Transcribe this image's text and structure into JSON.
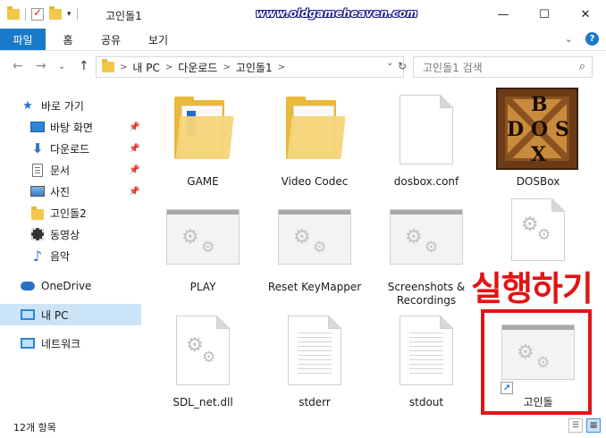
{
  "window": {
    "title": "고인돌1",
    "watermark": "www.oldgameheaven.com",
    "minimize": "—",
    "maximize": "☐",
    "close": "✕"
  },
  "ribbon": {
    "tabs": [
      "파일",
      "홈",
      "공유",
      "보기"
    ],
    "collapse": "⌄",
    "help": "?"
  },
  "nav": {
    "back": "←",
    "forward": "→",
    "recent": "⌄",
    "up": "↑",
    "path": [
      "내 PC",
      "다운로드",
      "고인돌1"
    ],
    "path_sep": ">",
    "path_dropdown": "⌄",
    "refresh": "↻",
    "search_placeholder": "고인돌1 검색",
    "search_icon": "⌕"
  },
  "sidebar": {
    "items": [
      {
        "label": "바로 가기",
        "icon": "star-icon",
        "pinned": false
      },
      {
        "label": "바탕 화면",
        "icon": "desktop-icon",
        "pinned": true
      },
      {
        "label": "다운로드",
        "icon": "download-icon",
        "pinned": true
      },
      {
        "label": "문서",
        "icon": "document-icon",
        "pinned": true
      },
      {
        "label": "사진",
        "icon": "pictures-icon",
        "pinned": true
      },
      {
        "label": "고인돌2",
        "icon": "folder-icon",
        "pinned": false
      },
      {
        "label": "동영상",
        "icon": "video-icon",
        "pinned": false
      },
      {
        "label": "음악",
        "icon": "music-icon",
        "pinned": false
      },
      {
        "label": "OneDrive",
        "icon": "onedrive-icon",
        "pinned": false
      },
      {
        "label": "내 PC",
        "icon": "pc-icon",
        "pinned": false
      },
      {
        "label": "네트워크",
        "icon": "network-icon",
        "pinned": false
      }
    ],
    "pin_glyph": "📌"
  },
  "files": [
    {
      "name": "GAME",
      "type": "folder"
    },
    {
      "name": "Video Codec",
      "type": "folder"
    },
    {
      "name": "dosbox.conf",
      "type": "file"
    },
    {
      "name": "DOSBox",
      "type": "dosbox"
    },
    {
      "name": "PLAY",
      "type": "exe"
    },
    {
      "name": "Reset KeyMapper",
      "type": "exe"
    },
    {
      "name": "Screenshots & Recordings",
      "type": "exe"
    },
    {
      "name": "",
      "type": "page-gear"
    },
    {
      "name": "SDL_net.dll",
      "type": "page-gear"
    },
    {
      "name": "stderr",
      "type": "text"
    },
    {
      "name": "stdout",
      "type": "text"
    },
    {
      "name": "고인돌",
      "type": "exe-shortcut"
    }
  ],
  "dosbox_letters": {
    "top": "B",
    "left": "D",
    "center": "O",
    "right": "S",
    "bottom": "X"
  },
  "callout": "실행하기",
  "shortcut_arrow": "↗",
  "gear_glyph": "⚙",
  "status": {
    "count": "12개 항목",
    "details_view": "☰",
    "icons_view": "▦"
  },
  "colors": {
    "accent": "#1979ca",
    "highlight": "#e01616",
    "selected": "#cce4f7"
  }
}
